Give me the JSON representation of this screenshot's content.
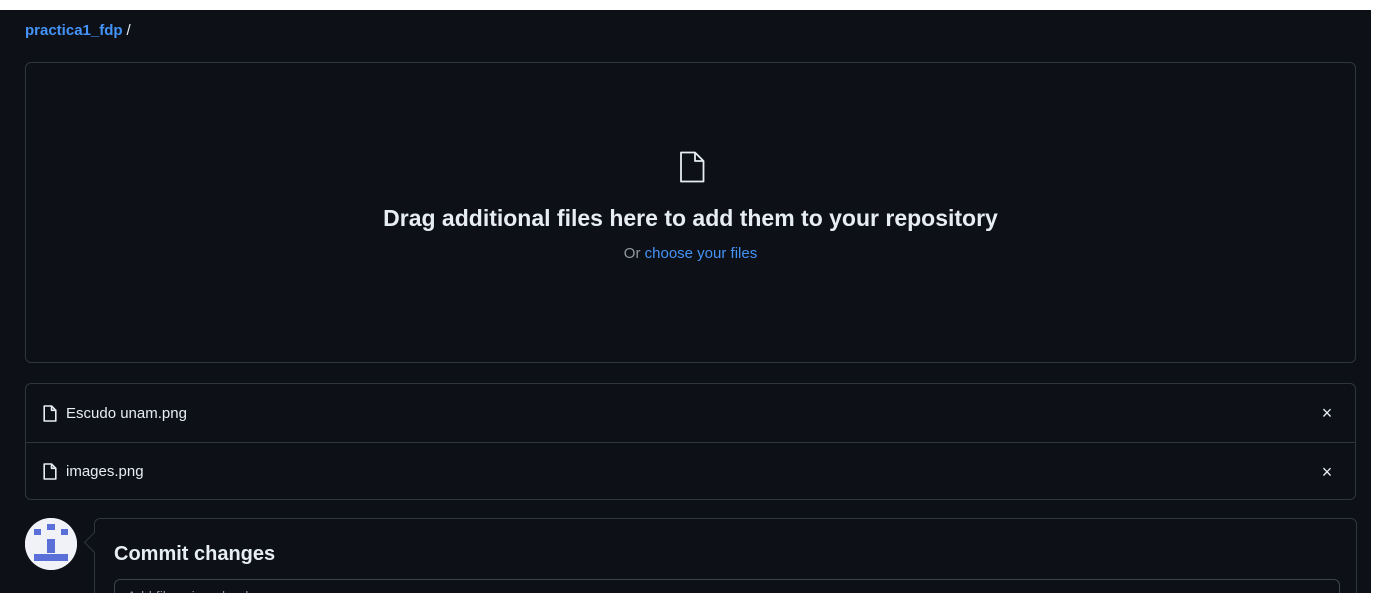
{
  "breadcrumb": {
    "repo": "practica1_fdp",
    "separator": "/"
  },
  "dropzone": {
    "icon": "file-icon",
    "headline": "Drag additional files here to add them to your repository",
    "prefix": "Or",
    "link": "choose your files"
  },
  "files": [
    {
      "name": "Escudo unam.png",
      "icon": "file-icon",
      "remove": "×"
    },
    {
      "name": "images.png",
      "icon": "file-icon",
      "remove": "×"
    }
  ],
  "commit": {
    "title": "Commit changes",
    "summary_placeholder": "Add files via upload"
  },
  "colors": {
    "background": "#0d1117",
    "border": "#30363d",
    "text": "#e6edf3",
    "muted": "#9198a1",
    "link": "#4493f8",
    "avatar": "#5b6fd8"
  }
}
